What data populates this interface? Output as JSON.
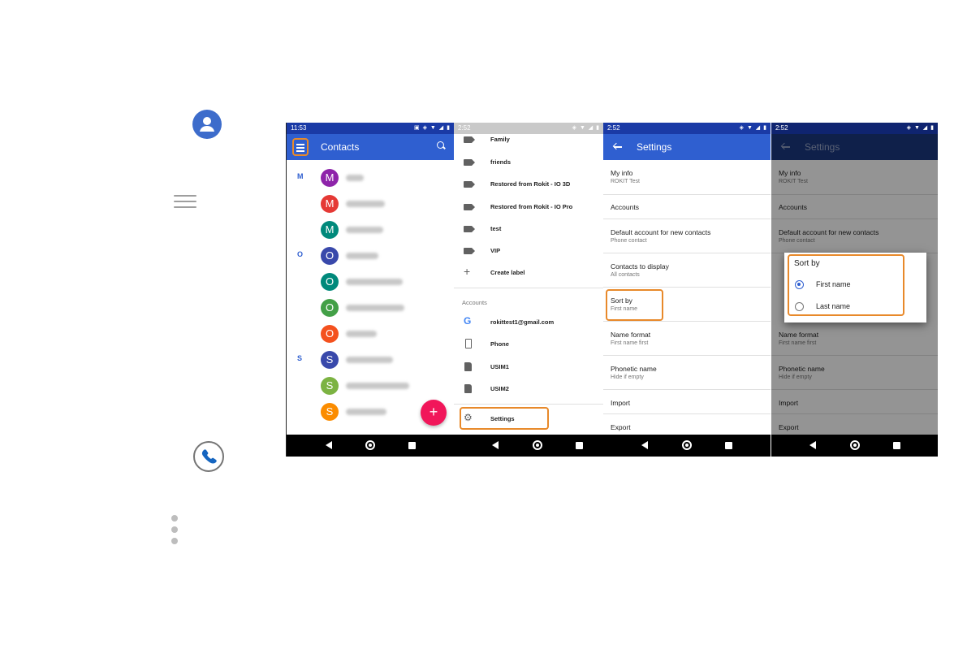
{
  "colors": {
    "accent": "#2f5fd0",
    "highlight": "#e8892a",
    "fab": "#f1165a"
  },
  "sidebar_icons": [
    "contacts-icon",
    "menu-icon",
    "phone-icon",
    "more-vert-icon"
  ],
  "panel1": {
    "time": "11:53",
    "title": "Contacts",
    "sections": [
      {
        "letter": "M",
        "avatars": [
          "M",
          "M",
          "M"
        ]
      },
      {
        "letter": "O",
        "avatars": [
          "O",
          "O",
          "O",
          "O"
        ]
      },
      {
        "letter": "S",
        "avatars": [
          "S",
          "S",
          "S"
        ]
      }
    ],
    "fab_label": "+"
  },
  "panel2": {
    "time": "2:52",
    "labels": [
      "Family",
      "friends",
      "Restored from Rokit - IO 3D",
      "Restored from Rokit - IO Pro",
      "test",
      "VIP"
    ],
    "create_label": "Create label",
    "accounts_header": "Accounts",
    "accounts": [
      "rokittest1@gmail.com",
      "Phone",
      "USIM1",
      "USIM2"
    ],
    "settings": "Settings"
  },
  "panel3": {
    "time": "2:52",
    "title": "Settings",
    "rows": [
      {
        "title": "My info",
        "sub": "ROKIT Test"
      },
      {
        "title": "Accounts",
        "sub": ""
      },
      {
        "title": "Default account for new contacts",
        "sub": "Phone contact"
      },
      {
        "title": "Contacts to display",
        "sub": "All contacts"
      },
      {
        "title": "Sort by",
        "sub": "First name"
      },
      {
        "title": "Name format",
        "sub": "First name first"
      },
      {
        "title": "Phonetic name",
        "sub": "Hide if empty"
      },
      {
        "title": "Import",
        "sub": ""
      },
      {
        "title": "Export",
        "sub": ""
      }
    ]
  },
  "panel4": {
    "time": "2:52",
    "title": "Settings",
    "rows": [
      {
        "title": "My info",
        "sub": "ROKIT Test"
      },
      {
        "title": "Accounts",
        "sub": ""
      },
      {
        "title": "Default account for new contacts",
        "sub": "Phone contact"
      },
      {
        "title": "Name format",
        "sub": "First name first"
      },
      {
        "title": "Phonetic name",
        "sub": "Hide if empty"
      },
      {
        "title": "Import",
        "sub": ""
      },
      {
        "title": "Export",
        "sub": ""
      }
    ],
    "dialog": {
      "title": "Sort by",
      "options": [
        {
          "label": "First name",
          "selected": true
        },
        {
          "label": "Last name",
          "selected": false
        }
      ]
    }
  }
}
